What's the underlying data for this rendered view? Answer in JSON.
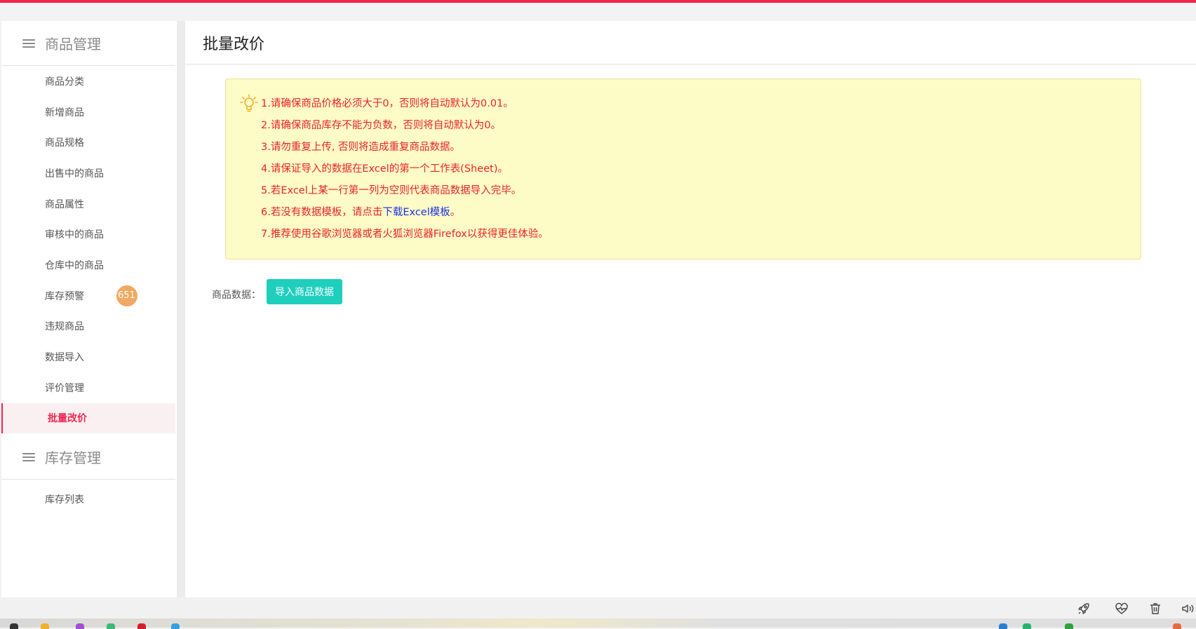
{
  "colors": {
    "accent": "#f5244f",
    "button": "#1ecfbd",
    "badge": "#f0a863",
    "notice_bg": "#fefcc6",
    "notice_text": "#e8232a",
    "link": "#1a31e8"
  },
  "sidebar": {
    "group1": {
      "title": "商品管理",
      "items": [
        {
          "label": "商品分类"
        },
        {
          "label": "新增商品"
        },
        {
          "label": "商品规格"
        },
        {
          "label": "出售中的商品"
        },
        {
          "label": "商品属性"
        },
        {
          "label": "审核中的商品"
        },
        {
          "label": "仓库中的商品"
        },
        {
          "label": "库存预警",
          "badge": "651"
        },
        {
          "label": "违规商品"
        },
        {
          "label": "数据导入"
        },
        {
          "label": "评价管理"
        },
        {
          "label": "批量改价",
          "active": true
        }
      ]
    },
    "group2": {
      "title": "库存管理",
      "items": [
        {
          "label": "库存列表"
        }
      ]
    }
  },
  "main": {
    "title": "批量改价",
    "notice": {
      "icon": "lightbulb-icon",
      "lines": [
        "1.请确保商品价格必须大于0，否则将自动默认为0.01。",
        "2.请确保商品库存不能为负数，否则将自动默认为0。",
        "3.请勿重复上传, 否则将造成重复商品数据。",
        "4.请保证导入的数据在Excel的第一个工作表(Sheet)。",
        "5.若Excel上某一行第一列为空则代表商品数据导入完毕。"
      ],
      "line6_prefix": "6.若没有数据模板，请点击",
      "line6_link": "下载Excel模板",
      "line6_suffix": "。",
      "line7": "7.推荐使用谷歌浏览器或者火狐浏览器Firefox以获得更佳体验。"
    },
    "data_label": "商品数据：",
    "import_button": "导入商品数据"
  },
  "bottom_tools": [
    "rocket-icon",
    "heartbeat-icon",
    "trash-icon",
    "volume-icon"
  ]
}
